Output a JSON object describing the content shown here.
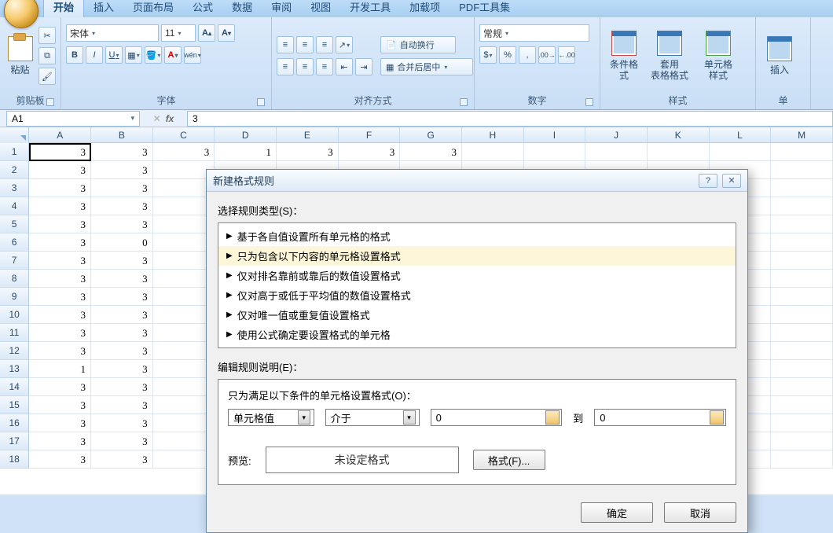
{
  "tabs": {
    "items": [
      "开始",
      "插入",
      "页面布局",
      "公式",
      "数据",
      "审阅",
      "视图",
      "开发工具",
      "加载项",
      "PDF工具集"
    ],
    "active_index": 0
  },
  "ribbon": {
    "clipboard": {
      "paste": "粘贴",
      "group": "剪贴板"
    },
    "font": {
      "group": "字体",
      "name": "宋体",
      "size": "11",
      "bold": "B",
      "italic": "I",
      "underline": "U",
      "grow": "A",
      "shrink": "A"
    },
    "align": {
      "group": "对齐方式",
      "wrap": "自动换行",
      "merge": "合并后居中"
    },
    "number": {
      "group": "数字",
      "format": "常规",
      "percent": "%",
      "comma": ","
    },
    "styles": {
      "group": "样式",
      "cond": "条件格式",
      "tablefmt": "套用\n表格格式",
      "cellstyle": "单元格\n样式"
    },
    "cells": {
      "group": "单",
      "insert": "插入"
    }
  },
  "fxrow": {
    "name": "A1",
    "fx": "fx",
    "formula": "3"
  },
  "sheet": {
    "cols": [
      "A",
      "B",
      "C",
      "D",
      "E",
      "F",
      "G",
      "H",
      "I",
      "J",
      "K",
      "L",
      "M"
    ],
    "rows": [
      1,
      2,
      3,
      4,
      5,
      6,
      7,
      8,
      9,
      10,
      11,
      12,
      13,
      14,
      15,
      16,
      17,
      18
    ],
    "data": {
      "1": {
        "A": "3",
        "B": "3",
        "C": "3",
        "D": "1",
        "E": "3",
        "F": "3",
        "G": "3"
      },
      "2": {
        "A": "3",
        "B": "3"
      },
      "3": {
        "A": "3",
        "B": "3"
      },
      "4": {
        "A": "3",
        "B": "3"
      },
      "5": {
        "A": "3",
        "B": "3"
      },
      "6": {
        "A": "3",
        "B": "0"
      },
      "7": {
        "A": "3",
        "B": "3"
      },
      "8": {
        "A": "3",
        "B": "3"
      },
      "9": {
        "A": "3",
        "B": "3"
      },
      "10": {
        "A": "3",
        "B": "3"
      },
      "11": {
        "A": "3",
        "B": "3"
      },
      "12": {
        "A": "3",
        "B": "3"
      },
      "13": {
        "A": "1",
        "B": "3"
      },
      "14": {
        "A": "3",
        "B": "3"
      },
      "15": {
        "A": "3",
        "B": "3"
      },
      "16": {
        "A": "3",
        "B": "3"
      },
      "17": {
        "A": "3",
        "B": "3"
      },
      "18": {
        "A": "3",
        "B": "3"
      }
    },
    "active": {
      "row": 1,
      "col": "A"
    }
  },
  "dialog": {
    "title": "新建格式规则",
    "help": "?",
    "close": "✕",
    "select_label": "选择规则类型(S)：",
    "select_hot": "S",
    "rule_types": [
      "基于各自值设置所有单元格的格式",
      "只为包含以下内容的单元格设置格式",
      "仅对排名靠前或靠后的数值设置格式",
      "仅对高于或低于平均值的数值设置格式",
      "仅对唯一值或重复值设置格式",
      "使用公式确定要设置格式的单元格"
    ],
    "rule_selected_index": 1,
    "edit_label": "编辑规则说明(E)：",
    "edit_hot": "E",
    "condition_label": "只为满足以下条件的单元格设置格式(O)：",
    "cond_hot": "O",
    "combo1": "单元格值",
    "combo2": "介于",
    "val1": "0",
    "between": "到",
    "val2": "0",
    "preview_label": "预览:",
    "preview_value": "未设定格式",
    "format_btn": "格式(F)...",
    "format_hot": "F",
    "ok": "确定",
    "cancel": "取消"
  }
}
